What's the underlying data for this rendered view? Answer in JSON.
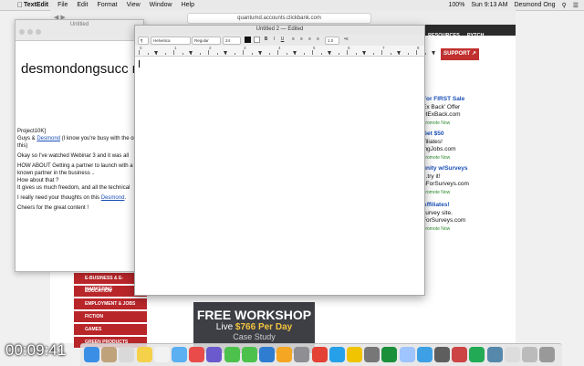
{
  "menubar": {
    "app_name": "TextEdit",
    "items": [
      "File",
      "Edit",
      "Format",
      "View",
      "Window",
      "Help"
    ],
    "battery": "100%",
    "day_time": "Sun 9:13 AM",
    "user": "Desmond Ong"
  },
  "browser": {
    "url": "quantumd.accounts.clickbank.com",
    "nav": [
      "RESOURCES",
      "PYTCH"
    ],
    "support_label": "SUPPORT",
    "ads": [
      {
        "title": "For FIRST Sale",
        "lines": [
          "Ex Back' Offer",
          "etExBack.com"
        ],
        "promote": "Promote Now"
      },
      {
        "title": "Get $50",
        "lines": [
          "ffiliates!",
          "ingJobs.com"
        ],
        "promote": "Promote Now"
      },
      {
        "title": "unity w/Surveys",
        "lines": [
          "...try it!",
          "hForSurveys.com"
        ],
        "promote": "Promote Now"
      },
      {
        "title": "Affiliates!",
        "lines": [
          "survey site.",
          "ForSurveys.com"
        ],
        "promote": "Promote Now"
      }
    ],
    "categories": [
      "E-BUSINESS & E-MARKETING",
      "EDUCATION",
      "EMPLOYMENT & JOBS",
      "FICTION",
      "GAMES",
      "GREEN PRODUCTS"
    ],
    "banner": {
      "line1": "FREE WORKSHOP",
      "line2_prefix": "Live ",
      "line2_price": "$766 Per Day",
      "line3": "Case Study"
    }
  },
  "doc_back": {
    "title": "Untitled",
    "heading": "desmondongsucc m",
    "paragraphs": [
      {
        "pre": "Project10K]\nGuys & ",
        "link": "Desmond",
        "post": " (I know you're busy with the on this)"
      },
      {
        "pre": "Okay so I've watched Webinar 3 and it was all",
        "link": "",
        "post": ""
      },
      {
        "pre": "HOW ABOUT Getting a partner to launch with a well known partner in the business ..\nHow about that ?\nIt gives us much freedom, and all the technical",
        "link": "",
        "post": ""
      },
      {
        "pre": "I really need your thoughts on this ",
        "link": "Desmond",
        "post": "."
      },
      {
        "pre": "Cheers for the great content !",
        "link": "",
        "post": ""
      }
    ]
  },
  "doc_front": {
    "title": "Untitled 2 — Edited",
    "paragraph_style": "¶",
    "font_family": "Helvetica",
    "font_style": "Regular",
    "font_size": "24",
    "line_spacing": "1.0",
    "ruler_numbers": [
      "0",
      "1",
      "2",
      "3",
      "4",
      "5",
      "6",
      "7",
      "8"
    ]
  },
  "timer": "00:09:41",
  "dock_colors": [
    "#3a8ee6",
    "#bfa27a",
    "#d9d9d9",
    "#f5d14a",
    "#f2f2f2",
    "#5ab0f0",
    "#e94b4b",
    "#6a5acd",
    "#4cc24c",
    "#4cc24c",
    "#2f7dd1",
    "#f5a623",
    "#8e8e93",
    "#e34234",
    "#26a0e8",
    "#f0c400",
    "#777",
    "#1b8f3a",
    "#9fc4ff",
    "#3da0e5",
    "#5e5e5e",
    "#c44",
    "#2a5",
    "#58a",
    "#ddd",
    "#bbb",
    "#999"
  ]
}
